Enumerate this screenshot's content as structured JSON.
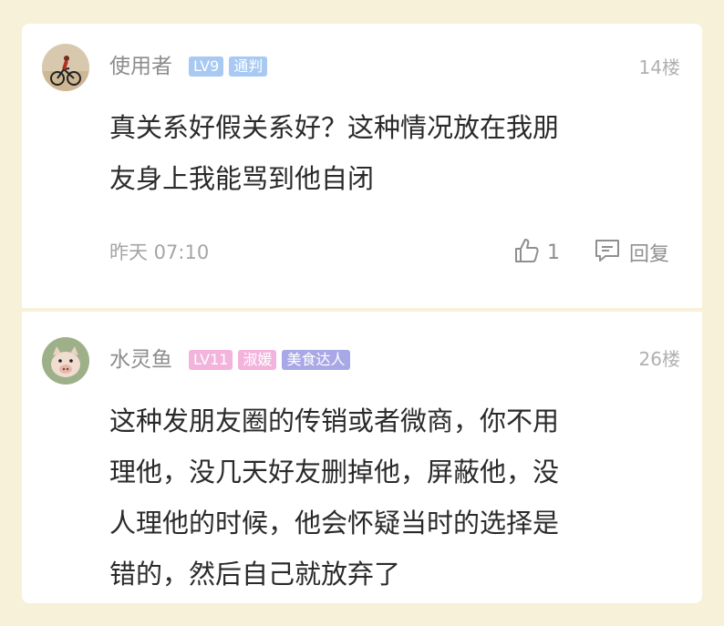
{
  "comments": [
    {
      "username": "使用者",
      "badges": [
        {
          "label": "LV9",
          "color": "#a7c9f2"
        },
        {
          "label": "通判",
          "color": "#a7c9f2"
        }
      ],
      "floor": "14楼",
      "content_lines": [
        "真关系好假关系好？这种情况放在我朋",
        "友身上我能骂到他自闭"
      ],
      "time": "昨天 07:10",
      "like_count": "1",
      "reply_label": "回复",
      "avatar_icon": "cyclist-avatar-icon"
    },
    {
      "username": "水灵鱼",
      "badges": [
        {
          "label": "LV11",
          "color": "#f2b4dc"
        },
        {
          "label": "淑媛",
          "color": "#f2b4dc"
        },
        {
          "label": "美食达人",
          "color": "#a9a8e6"
        }
      ],
      "floor": "26楼",
      "content_lines": [
        "这种发朋友圈的传销或者微商，你不用",
        "理他，没几天好友删掉他，屏蔽他，没",
        "人理他的时候，他会怀疑当时的选择是",
        "错的，然后自己就放弃了"
      ],
      "avatar_icon": "piglet-avatar-icon"
    }
  ],
  "colors": {
    "page_bg": "#f7f1d9",
    "card_bg": "#ffffff"
  }
}
